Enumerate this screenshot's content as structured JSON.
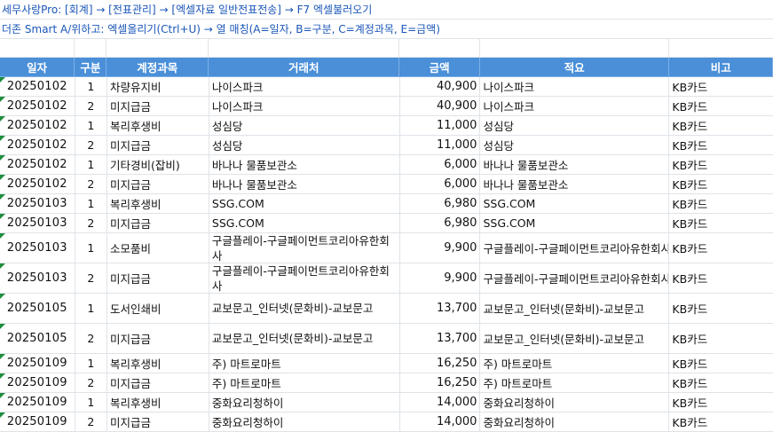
{
  "note1": "세무사랑Pro: [회계] → [전표관리] → [엑셀자료 일반전표전송] → F7 엑셀불러오기",
  "note2": "더존 Smart A/위하고: 엑셀올리기(Ctrl+U) → 열 매칭(A=일자, B=구분, C=계정과목, E=금액)",
  "headers": {
    "date": "일자",
    "type": "구분",
    "account": "계정과목",
    "vendor": "거래처",
    "amount": "금액",
    "memo": "적요",
    "remark": "비고"
  },
  "colors": {
    "header_bg": "#4a8fd8",
    "note_text": "#1a56b8",
    "marker": "#1e8e3e"
  },
  "rows": [
    {
      "date": "20250102",
      "type": "1",
      "account": "차량유지비",
      "vendor": "나이스파크",
      "amount": "40,900",
      "memo": "나이스파크",
      "remark": "KB카드"
    },
    {
      "date": "20250102",
      "type": "2",
      "account": "미지급금",
      "vendor": "나이스파크",
      "amount": "40,900",
      "memo": "나이스파크",
      "remark": "KB카드"
    },
    {
      "date": "20250102",
      "type": "1",
      "account": "복리후생비",
      "vendor": "성심당",
      "amount": "11,000",
      "memo": "성심당",
      "remark": "KB카드"
    },
    {
      "date": "20250102",
      "type": "2",
      "account": "미지급금",
      "vendor": "성심당",
      "amount": "11,000",
      "memo": "성심당",
      "remark": "KB카드"
    },
    {
      "date": "20250102",
      "type": "1",
      "account": "기타경비(잡비)",
      "vendor": "바나나 물품보관소",
      "amount": "6,000",
      "memo": "바나나 물품보관소",
      "remark": "KB카드"
    },
    {
      "date": "20250102",
      "type": "2",
      "account": "미지급금",
      "vendor": "바나나 물품보관소",
      "amount": "6,000",
      "memo": "바나나 물품보관소",
      "remark": "KB카드"
    },
    {
      "date": "20250103",
      "type": "1",
      "account": "복리후생비",
      "vendor": "SSG.COM",
      "amount": "6,980",
      "memo": "SSG.COM",
      "remark": "KB카드"
    },
    {
      "date": "20250103",
      "type": "2",
      "account": "미지급금",
      "vendor": "SSG.COM",
      "amount": "6,980",
      "memo": "SSG.COM",
      "remark": "KB카드"
    },
    {
      "date": "20250103",
      "type": "1",
      "account": "소모품비",
      "vendor": "구글플레이-구글페이먼트코리아유한회사",
      "amount": "9,900",
      "memo": "구글플레이-구글페이먼트코리아유한회사",
      "remark": "KB카드"
    },
    {
      "date": "20250103",
      "type": "2",
      "account": "미지급금",
      "vendor": "구글플레이-구글페이먼트코리아유한회사",
      "amount": "9,900",
      "memo": "구글플레이-구글페이먼트코리아유한회사",
      "remark": "KB카드"
    },
    {
      "date": "20250105",
      "type": "1",
      "account": "도서인쇄비",
      "vendor": "교보문고_인터넷(문화비)-교보문고",
      "amount": "13,700",
      "memo": "교보문고_인터넷(문화비)-교보문고",
      "remark": "KB카드"
    },
    {
      "date": "20250105",
      "type": "2",
      "account": "미지급금",
      "vendor": "교보문고_인터넷(문화비)-교보문고",
      "amount": "13,700",
      "memo": "교보문고_인터넷(문화비)-교보문고",
      "remark": "KB카드"
    },
    {
      "date": "20250109",
      "type": "1",
      "account": "복리후생비",
      "vendor": "주) 마트로마트",
      "amount": "16,250",
      "memo": "주) 마트로마트",
      "remark": "KB카드"
    },
    {
      "date": "20250109",
      "type": "2",
      "account": "미지급금",
      "vendor": "주) 마트로마트",
      "amount": "16,250",
      "memo": "주) 마트로마트",
      "remark": "KB카드"
    },
    {
      "date": "20250109",
      "type": "1",
      "account": "복리후생비",
      "vendor": "중화요리청하이",
      "amount": "14,000",
      "memo": "중화요리청하이",
      "remark": "KB카드"
    },
    {
      "date": "20250109",
      "type": "2",
      "account": "미지급금",
      "vendor": "중화요리청하이",
      "amount": "14,000",
      "memo": "중화요리청하이",
      "remark": "KB카드"
    }
  ]
}
